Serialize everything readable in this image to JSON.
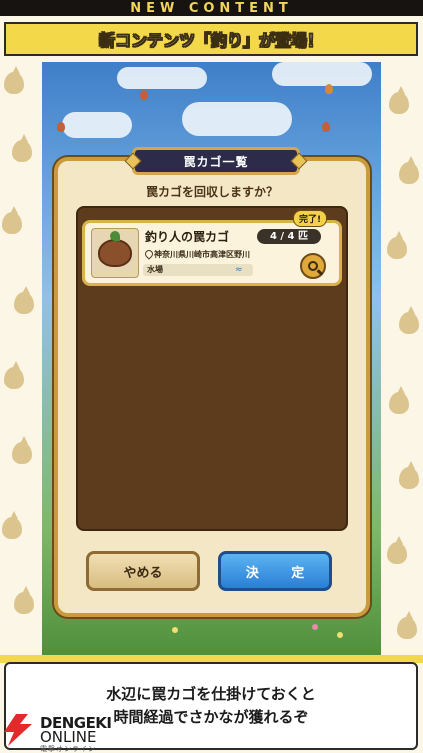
{
  "header": {
    "title": "NEW CONTENT",
    "banner": "新コンテンツ「釣り」が登場！"
  },
  "dialog": {
    "title": "罠カゴ一覧",
    "question": "罠カゴを回収しますか？",
    "item": {
      "name": "釣り人の罠カゴ",
      "count": "4 / 4 匹",
      "badge": "完了!",
      "location": "神奈川県川崎市高津区野川",
      "type": "水場"
    },
    "cancel_label": "やめる",
    "ok_label": "決 定"
  },
  "caption": {
    "line1": "水辺に罠カゴを仕掛けておくと",
    "line2": "時間経過でさかなが獲れるぞ"
  },
  "logo": {
    "line1": "DENGEKI",
    "line2": "ONLINE",
    "line3": "電撃オンライン"
  },
  "colors": {
    "accent_yellow": "#f3d84a",
    "dialog_frame": "#c99a3e",
    "ok_button": "#2a7ed6"
  }
}
